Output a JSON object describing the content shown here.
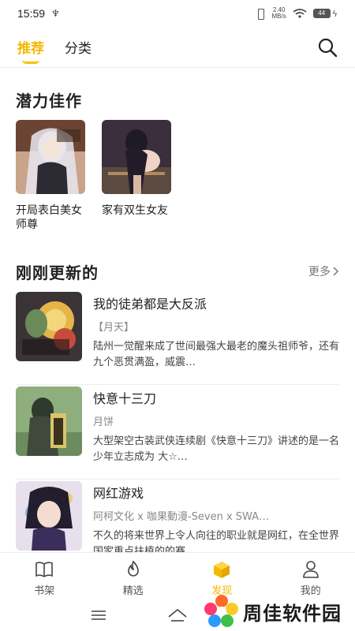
{
  "status": {
    "time": "15:59",
    "usb": "♆",
    "speed": "2.40\nMB/s",
    "battery": "44"
  },
  "header": {
    "tabs": [
      {
        "label": "推荐"
      },
      {
        "label": "分类"
      }
    ]
  },
  "potential": {
    "title": "潜力佳作",
    "items": [
      {
        "title": "开局表白美女师尊"
      },
      {
        "title": "家有双生女友"
      }
    ]
  },
  "updated": {
    "title": "刚刚更新的",
    "more": "更多",
    "items": [
      {
        "title": "我的徒弟都是大反派",
        "author": "【月天】",
        "desc": "陆州一觉醒来成了世间最强大最老的魔头祖师爷，还有九个恶贯满盈，威震…"
      },
      {
        "title": "快意十三刀",
        "author": "月饼",
        "desc": "大型架空古装武侠连续剧《快意十三刀》讲述的是一名少年立志成为 大☆…"
      },
      {
        "title": "网红游戏",
        "author": "阿柯文化 x 咖果動漫-Seven x SWA…",
        "desc": "不久的将来世界上令人向往的职业就是网红，在全世界国家重点扶植的的赛…"
      }
    ]
  },
  "bottom_nav": {
    "items": [
      {
        "label": "书架"
      },
      {
        "label": "精选"
      },
      {
        "label": "发现"
      },
      {
        "label": "我的"
      }
    ]
  },
  "watermark": {
    "text": "周佳软件园"
  },
  "colors": {
    "accent": "#f5b800"
  }
}
